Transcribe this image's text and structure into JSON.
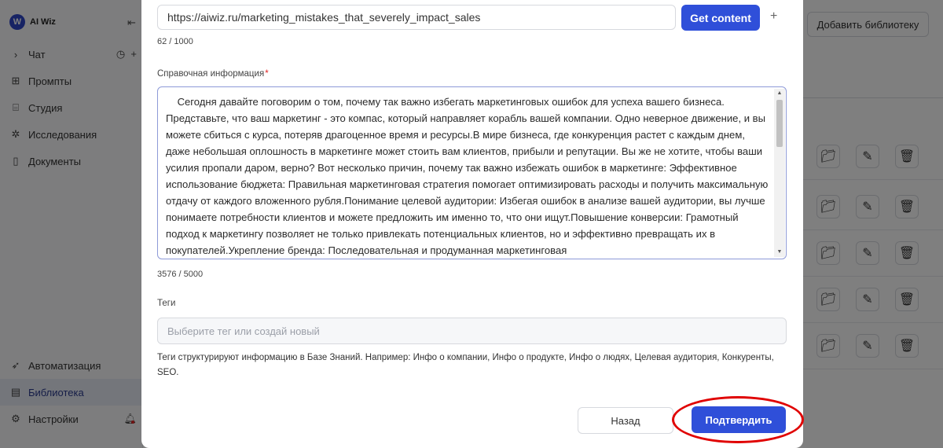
{
  "app": {
    "brand": "AI Wiz",
    "sidebar_top": [
      {
        "label": "Чат",
        "icon": "chevron-right-icon"
      },
      {
        "label": "Промпты",
        "icon": "grid-icon"
      },
      {
        "label": "Студия",
        "icon": "studio-icon"
      },
      {
        "label": "Исследования",
        "icon": "research-icon"
      },
      {
        "label": "Документы",
        "icon": "document-icon"
      }
    ],
    "sidebar_bottom": [
      {
        "label": "Автоматизация",
        "icon": "rocket-icon"
      },
      {
        "label": "Библиотека",
        "icon": "library-icon"
      },
      {
        "label": "Настройки",
        "icon": "gear-icon"
      }
    ],
    "add_library_label": "Добавить библиотеку"
  },
  "modal": {
    "url_value": "https://aiwiz.ru/marketing_mistakes_that_severely_impact_sales",
    "get_content_label": "Get content",
    "url_counter": "62 / 1000",
    "reference_label": "Справочная информация",
    "required_mark": "*",
    "reference_text": "    Сегодня давайте поговорим о том, почему так важно избегать маркетинговых ошибок для успеха вашего бизнеса. Представьте, что ваш маркетинг - это компас, который направляет корабль вашей компании. Одно неверное движение, и вы можете сбиться с курса, потеряв драгоценное время и ресурсы.В мире бизнеса, где конкуренция растет с каждым днем, даже небольшая оплошность в маркетинге может стоить вам клиентов, прибыли и репутации. Вы же не хотите, чтобы ваши усилия пропали даром, верно? Вот несколько причин, почему так важно избежать ошибок в маркетинге: Эффективное использование бюджета: Правильная маркетинговая стратегия помогает оптимизировать расходы и получить максимальную отдачу от каждого вложенного рубля.Понимание целевой аудитории: Избегая ошибок в анализе вашей аудитории, вы лучше понимаете потребности клиентов и можете предложить им именно то, что они ищут.Повышение конверсии: Грамотный подход к маркетингу позволяет не только привлекать потенциальных клиентов, но и эффективно превращать их в покупателей.Укрепление бренда: Последовательная и продуманная маркетинговая",
    "reference_counter": "3576 / 5000",
    "tags_label": "Теги",
    "tags_placeholder": "Выберите тег или создай новый",
    "tags_help": "Теги структурируют информацию в Базе Знаний. Например: Инфо о компании, Инфо о продукте, Инфо о людях, Целевая аудитория, Конкуренты, SEO.",
    "back_label": "Назад",
    "confirm_label": "Подтвердить"
  },
  "colors": {
    "accent": "#2f4fd9",
    "highlight": "#e00000",
    "overlay": "#7f7f7f"
  }
}
